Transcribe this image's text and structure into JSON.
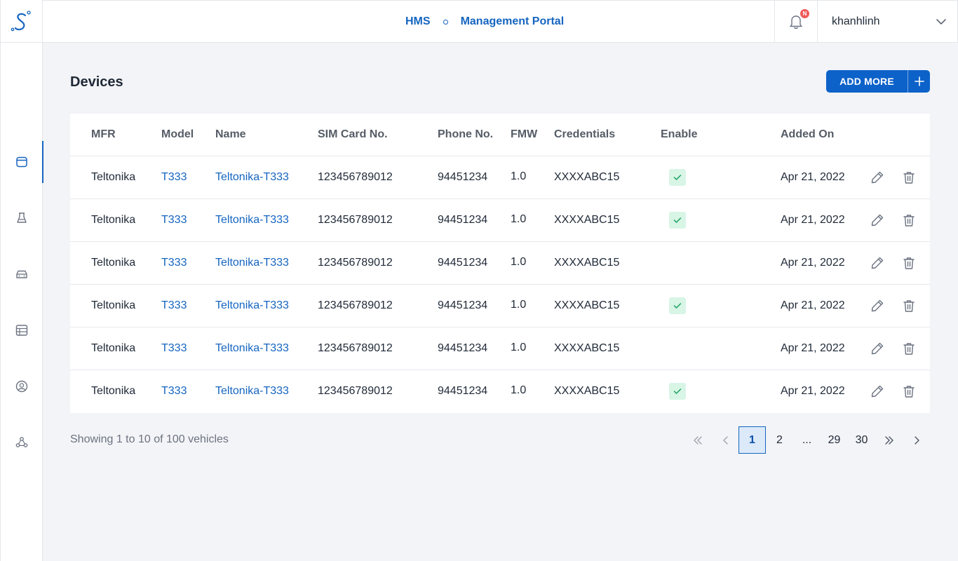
{
  "header": {
    "brand_left": "HMS",
    "brand_right": "Management Portal",
    "notification_badge": "N",
    "username": "khanhlinh"
  },
  "sidebar": {
    "items": [
      {
        "icon": "devices-icon",
        "active": true
      },
      {
        "icon": "beacon-icon",
        "active": false
      },
      {
        "icon": "car-icon",
        "active": false
      },
      {
        "icon": "list-icon",
        "active": false
      },
      {
        "icon": "user-circle-icon",
        "active": false
      },
      {
        "icon": "network-icon",
        "active": false
      }
    ]
  },
  "page": {
    "title": "Devices",
    "add_button": "ADD MORE"
  },
  "table": {
    "columns": [
      "MFR",
      "Model",
      "Name",
      "SIM Card No.",
      "Phone No.",
      "FMW",
      "Credentials",
      "Enable",
      "Added On"
    ],
    "rows": [
      {
        "mfr": "Teltonika",
        "model": "T333",
        "name": "Teltonika-T333",
        "sim": "123456789012",
        "phone": "94451234",
        "fmw": "1.0",
        "cred": "XXXXABC15",
        "enabled": true,
        "added": "Apr 21, 2022"
      },
      {
        "mfr": "Teltonika",
        "model": "T333",
        "name": "Teltonika-T333",
        "sim": "123456789012",
        "phone": "94451234",
        "fmw": "1.0",
        "cred": "XXXXABC15",
        "enabled": true,
        "added": "Apr 21, 2022"
      },
      {
        "mfr": "Teltonika",
        "model": "T333",
        "name": "Teltonika-T333",
        "sim": "123456789012",
        "phone": "94451234",
        "fmw": "1.0",
        "cred": "XXXXABC15",
        "enabled": false,
        "added": "Apr 21, 2022"
      },
      {
        "mfr": "Teltonika",
        "model": "T333",
        "name": "Teltonika-T333",
        "sim": "123456789012",
        "phone": "94451234",
        "fmw": "1.0",
        "cred": "XXXXABC15",
        "enabled": true,
        "added": "Apr 21, 2022"
      },
      {
        "mfr": "Teltonika",
        "model": "T333",
        "name": "Teltonika-T333",
        "sim": "123456789012",
        "phone": "94451234",
        "fmw": "1.0",
        "cred": "XXXXABC15",
        "enabled": false,
        "added": "Apr 21, 2022"
      },
      {
        "mfr": "Teltonika",
        "model": "T333",
        "name": "Teltonika-T333",
        "sim": "123456789012",
        "phone": "94451234",
        "fmw": "1.0",
        "cred": "XXXXABC15",
        "enabled": true,
        "added": "Apr 21, 2022"
      }
    ]
  },
  "footer": {
    "showing": "Showing 1 to 10 of 100 vehicles",
    "pages": [
      "1",
      "2",
      "...",
      "29",
      "30"
    ],
    "current_page": "1"
  },
  "colors": {
    "primary": "#1565c0",
    "button": "#0c62c9",
    "check_bg": "#d8f5e6",
    "check_mark": "#1aa260",
    "badge": "#ef5a5a",
    "background": "#f3f4f7"
  }
}
